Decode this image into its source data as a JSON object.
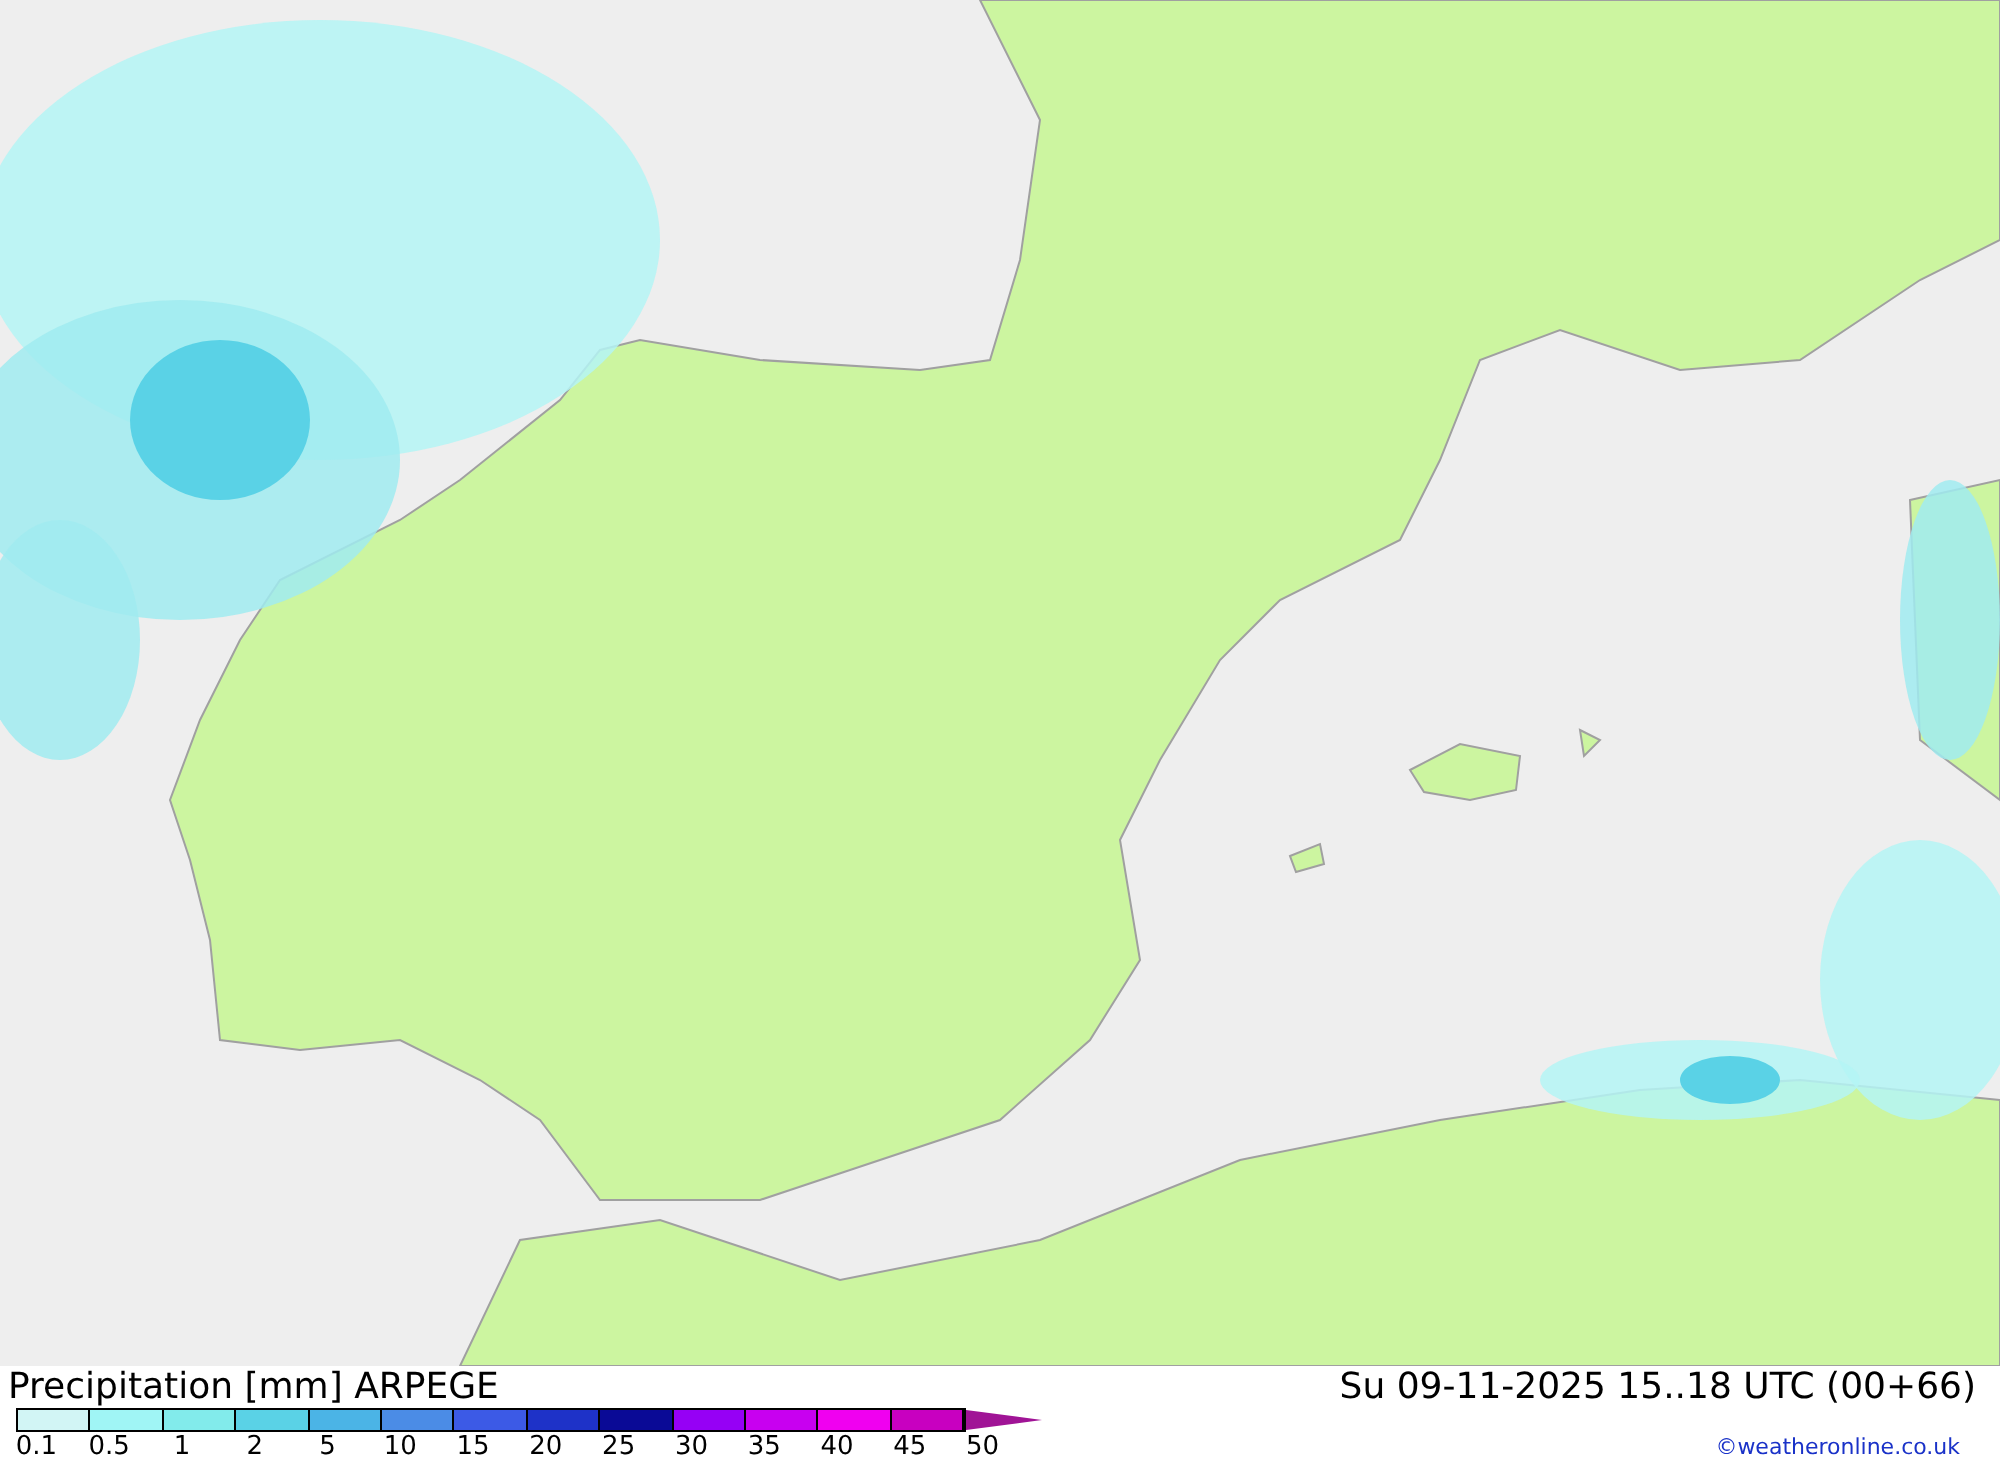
{
  "title": "Precipitation [mm] ARPEGE",
  "valid_time": "Su 09-11-2025 15..18 UTC (00+66)",
  "legend": {
    "labels": [
      "0.1",
      "0.5",
      "1",
      "2",
      "5",
      "10",
      "15",
      "20",
      "25",
      "30",
      "35",
      "40",
      "45",
      "50"
    ],
    "swatches": [
      {
        "color": "#d2f5f5"
      },
      {
        "color": "#a0f5f5"
      },
      {
        "color": "#82ebeb"
      },
      {
        "color": "#5ad2e6"
      },
      {
        "color": "#4bb4e6"
      },
      {
        "color": "#4b8ce6"
      },
      {
        "color": "#3c5ae6"
      },
      {
        "color": "#1e32c8"
      },
      {
        "color": "#0a0a96"
      },
      {
        "color": "#9600f5"
      },
      {
        "color": "#c800f0"
      },
      {
        "color": "#f000f0"
      },
      {
        "color": "#c800c0"
      }
    ]
  },
  "credit": "©weatheronline.co.uk"
}
